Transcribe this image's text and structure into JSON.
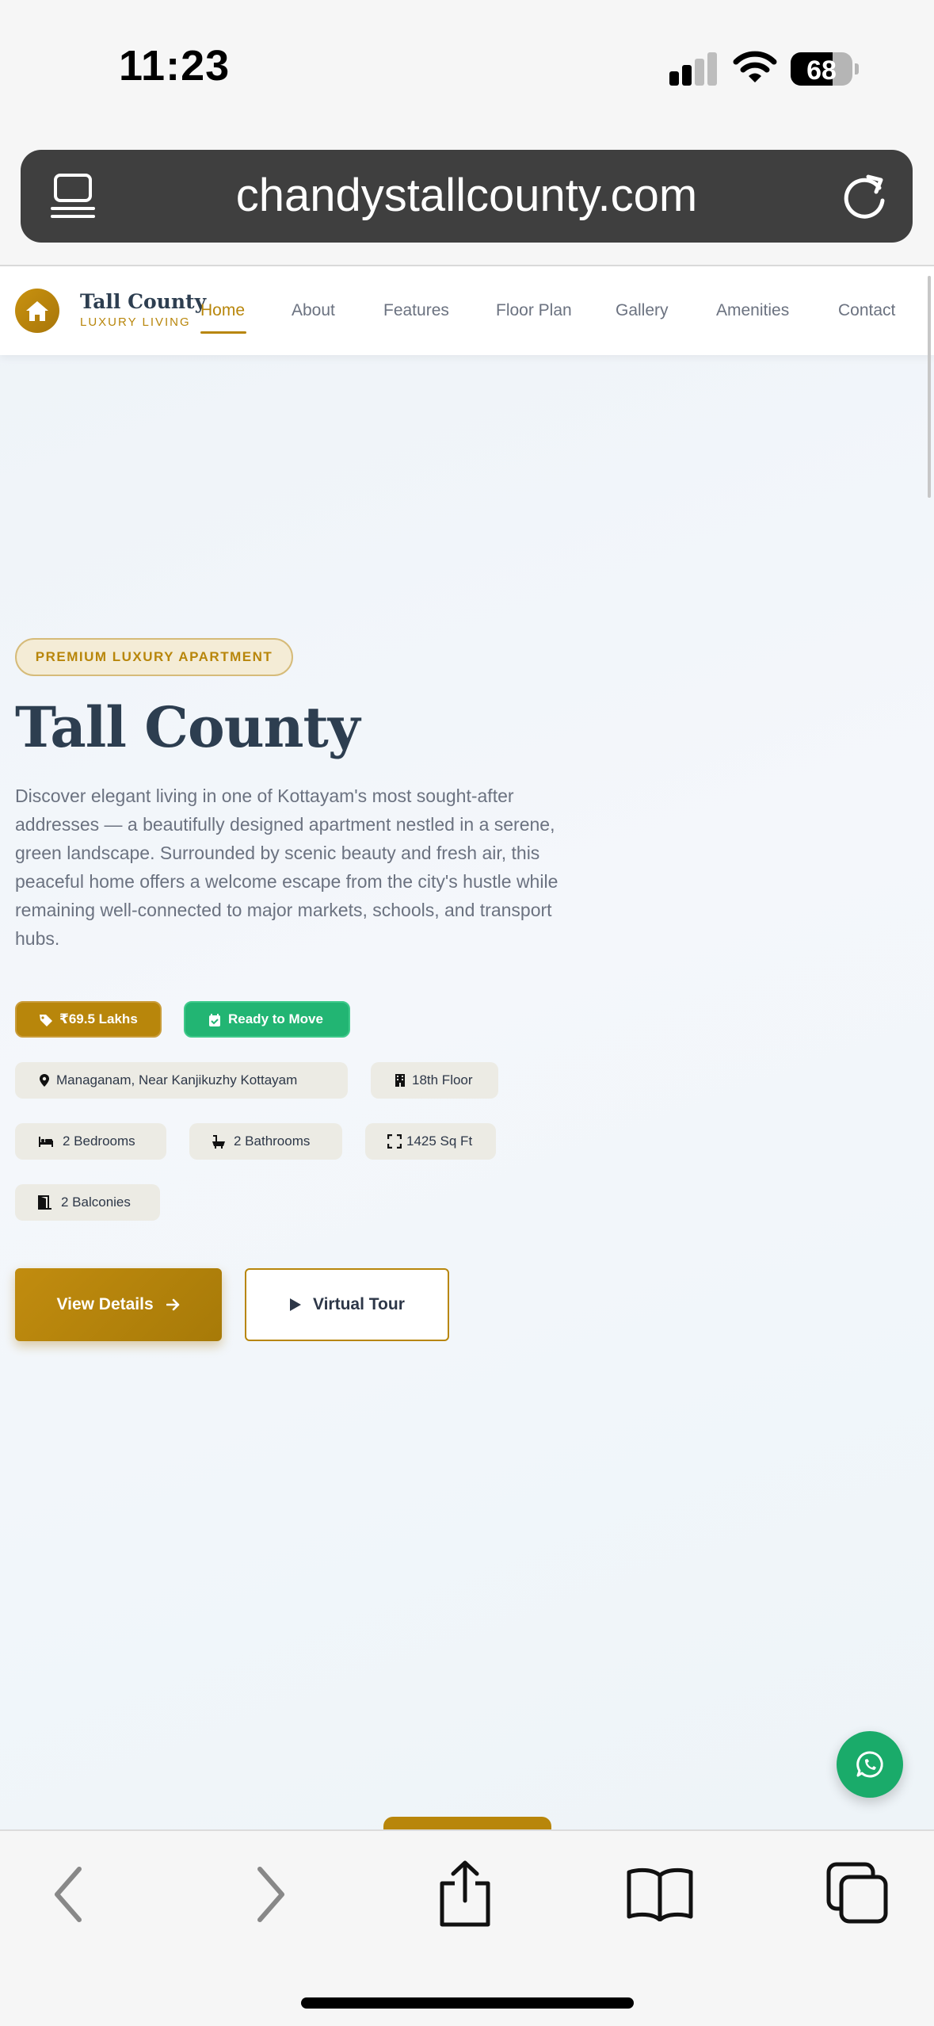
{
  "status_bar": {
    "time": "11:23",
    "battery": "68"
  },
  "browser": {
    "url": "chandystallcounty.com"
  },
  "site": {
    "brand": {
      "name": "Tall County",
      "tagline": "LUXURY LIVING"
    },
    "nav": [
      "Home",
      "About",
      "Features",
      "Floor Plan",
      "Gallery",
      "Amenities",
      "Contact"
    ],
    "active_nav": "Home",
    "hero": {
      "badge": "PREMIUM LUXURY APARTMENT",
      "title": "Tall County",
      "description": "Discover elegant living in one of Kottayam's most sought-after addresses — a beautifully designed apartment nestled in a serene, green landscape. Surrounded by scenic beauty and fresh air, this peaceful home offers a welcome escape from the city's hustle while remaining well-connected to major markets, schools, and transport hubs.",
      "price": "₹69.5 Lakhs",
      "status": "Ready to Move",
      "location": "Managanam, Near Kanjikuzhy Kottayam",
      "floor": "18th Floor",
      "bedrooms": "2 Bedrooms",
      "bathrooms": "2 Bathrooms",
      "area": "1425 Sq Ft",
      "balconies": "2 Balconies",
      "primary_button": "View Details",
      "secondary_button": "Virtual Tour"
    }
  },
  "colors": {
    "accent_gold": "#b8860b",
    "ready_green": "#22b573",
    "whatsapp_green": "#1aab6a",
    "title_navy": "#2d3e50"
  },
  "icons": [
    "reader-icon",
    "reload-icon",
    "home-icon",
    "tag-icon",
    "calendar-check-icon",
    "map-pin-icon",
    "building-icon",
    "bed-icon",
    "bath-icon",
    "expand-icon",
    "door-icon",
    "arrow-right-icon",
    "play-icon",
    "whatsapp-icon",
    "back-icon",
    "forward-icon",
    "share-icon",
    "bookmarks-icon",
    "tabs-icon"
  ]
}
